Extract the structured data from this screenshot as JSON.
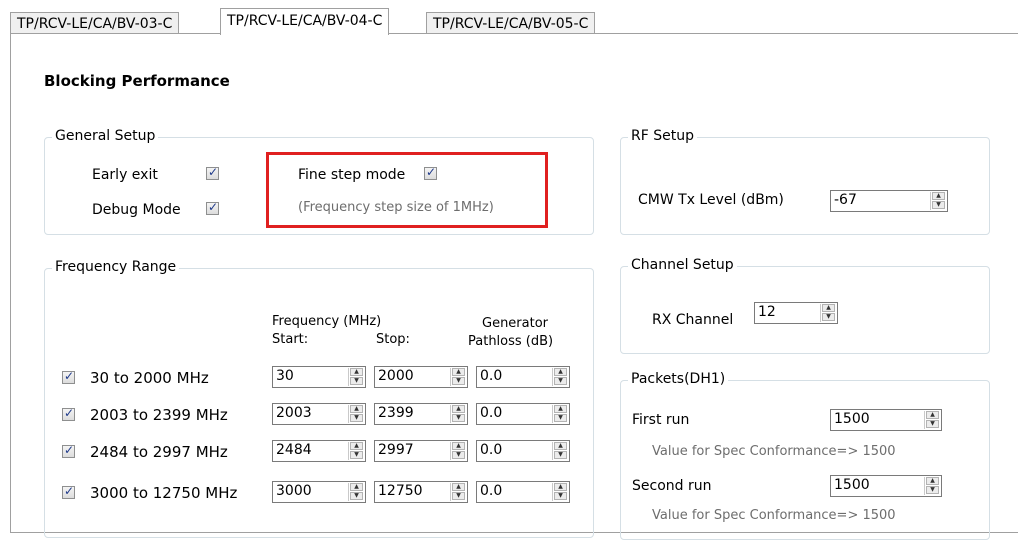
{
  "tabs": [
    "TP/RCV-LE/CA/BV-03-C",
    "TP/RCV-LE/CA/BV-04-C",
    "TP/RCV-LE/CA/BV-05-C"
  ],
  "heading": "Blocking Performance",
  "general": {
    "legend": "General Setup",
    "early_exit": "Early exit",
    "debug_mode": "Debug Mode",
    "fine_step": "Fine step mode",
    "fine_step_note": "(Frequency step size of 1MHz)"
  },
  "rf": {
    "legend": "RF Setup",
    "label": "CMW Tx Level (dBm)",
    "value": "-67"
  },
  "channel": {
    "legend": "Channel Setup",
    "label": "RX Channel",
    "value": "12"
  },
  "freq": {
    "legend": "Frequency Range",
    "col_freq": "Frequency (MHz)",
    "col_start": "Start:",
    "col_stop": "Stop:",
    "col_gen1": "Generator",
    "col_gen2": "Pathloss (dB)",
    "rows": [
      {
        "label": "30 to 2000 MHz",
        "start": "30",
        "stop": "2000",
        "loss": "0.0"
      },
      {
        "label": "2003 to 2399 MHz",
        "start": "2003",
        "stop": "2399",
        "loss": "0.0"
      },
      {
        "label": "2484 to 2997 MHz",
        "start": "2484",
        "stop": "2997",
        "loss": "0.0"
      },
      {
        "label": "3000 to 12750 MHz",
        "start": "3000",
        "stop": "12750",
        "loss": "0.0"
      }
    ]
  },
  "packets": {
    "legend": "Packets(DH1)",
    "first_label": "First run",
    "first_value": "1500",
    "first_note": "Value for Spec Conformance=> 1500",
    "second_label": "Second run",
    "second_value": "1500",
    "second_note": "Value for Spec Conformance=> 1500"
  }
}
